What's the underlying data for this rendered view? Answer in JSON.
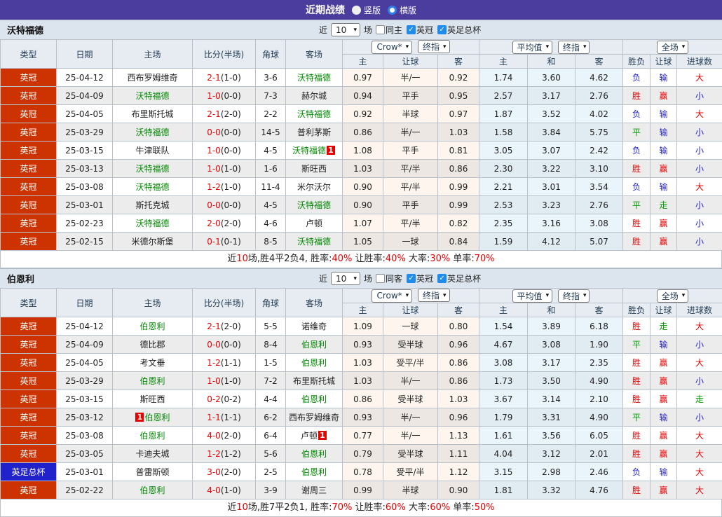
{
  "title_bar": {
    "title": "近期战绩",
    "options": [
      {
        "label": "竖版",
        "selected": true
      },
      {
        "label": "横版",
        "selected": false
      }
    ]
  },
  "icons": {
    "dropdown_arrow": "▾",
    "check": "✓"
  },
  "controls": {
    "near_label": "近",
    "count_value": "10",
    "games_label": "场"
  },
  "colors": {
    "accent_purple": "#4b3d9e",
    "league_red": "#cc3300",
    "league_blue": "#2222cc",
    "team_green": "#008800",
    "win_red": "#e60000",
    "lose_blue": "#2323cc",
    "draw_green": "#009900",
    "checkbox_blue": "#1f8ceb",
    "avg_col_bg": "#e9f4fb"
  },
  "header": {
    "left_cols": [
      "类型",
      "日期",
      "主场",
      "比分(半场)",
      "角球",
      "客场"
    ],
    "group_selects": {
      "g1a": "Crow*",
      "g1b": "终指",
      "g2a": "平均值",
      "g2b": "终指",
      "g3a": "全场"
    },
    "sub_cols": [
      "主",
      "让球",
      "客",
      "主",
      "和",
      "客",
      "胜负",
      "让球",
      "进球数"
    ]
  },
  "sections": [
    {
      "team": "沃特福德",
      "checkboxes": [
        {
          "label": "同主",
          "checked": false
        },
        {
          "label": "英冠",
          "checked": true
        },
        {
          "label": "英足总杯",
          "checked": true
        }
      ],
      "rows": [
        {
          "league": "英冠",
          "league_style": "red",
          "date": "25-04-12",
          "home": {
            "name": "西布罗姆维奇",
            "green": false
          },
          "score": "2-1",
          "half": "(1-0)",
          "corner": "3-6",
          "away": {
            "name": "沃特福德",
            "green": true
          },
          "odds": [
            "0.97",
            "半/一",
            "0.92",
            "1.74",
            "3.60",
            "4.62"
          ],
          "results": [
            [
              "负",
              "b"
            ],
            [
              "输",
              "b"
            ],
            [
              "大",
              "r"
            ]
          ]
        },
        {
          "league": "英冠",
          "league_style": "red",
          "date": "25-04-09",
          "home": {
            "name": "沃特福德",
            "green": true
          },
          "score": "1-0",
          "half": "(0-0)",
          "corner": "7-3",
          "away": {
            "name": "赫尔城",
            "green": false
          },
          "odds": [
            "0.94",
            "平手",
            "0.95",
            "2.57",
            "3.17",
            "2.76"
          ],
          "results": [
            [
              "胜",
              "r"
            ],
            [
              "赢",
              "r"
            ],
            [
              "小",
              "b"
            ]
          ]
        },
        {
          "league": "英冠",
          "league_style": "red",
          "date": "25-04-05",
          "home": {
            "name": "布里斯托城",
            "green": false
          },
          "score": "2-1",
          "half": "(2-0)",
          "corner": "2-2",
          "away": {
            "name": "沃特福德",
            "green": true
          },
          "odds": [
            "0.92",
            "半球",
            "0.97",
            "1.87",
            "3.52",
            "4.02"
          ],
          "results": [
            [
              "负",
              "b"
            ],
            [
              "输",
              "b"
            ],
            [
              "大",
              "r"
            ]
          ]
        },
        {
          "league": "英冠",
          "league_style": "red",
          "date": "25-03-29",
          "home": {
            "name": "沃特福德",
            "green": true
          },
          "score": "0-0",
          "half": "(0-0)",
          "corner": "14-5",
          "away": {
            "name": "普利茅斯",
            "green": false
          },
          "odds": [
            "0.86",
            "半/一",
            "1.03",
            "1.58",
            "3.84",
            "5.75"
          ],
          "results": [
            [
              "平",
              "g"
            ],
            [
              "输",
              "b"
            ],
            [
              "小",
              "b"
            ]
          ]
        },
        {
          "league": "英冠",
          "league_style": "red",
          "date": "25-03-15",
          "home": {
            "name": "牛津联队",
            "green": false
          },
          "score": "1-0",
          "half": "(0-0)",
          "corner": "4-5",
          "away": {
            "name": "沃特福德",
            "green": true,
            "badge_after": "1"
          },
          "odds": [
            "1.08",
            "平手",
            "0.81",
            "3.05",
            "3.07",
            "2.42"
          ],
          "results": [
            [
              "负",
              "b"
            ],
            [
              "输",
              "b"
            ],
            [
              "小",
              "b"
            ]
          ]
        },
        {
          "league": "英冠",
          "league_style": "red",
          "date": "25-03-13",
          "home": {
            "name": "沃特福德",
            "green": true
          },
          "score": "1-0",
          "half": "(1-0)",
          "corner": "1-6",
          "away": {
            "name": "斯旺西",
            "green": false
          },
          "odds": [
            "1.03",
            "平/半",
            "0.86",
            "2.30",
            "3.22",
            "3.10"
          ],
          "results": [
            [
              "胜",
              "r"
            ],
            [
              "赢",
              "r"
            ],
            [
              "小",
              "b"
            ]
          ]
        },
        {
          "league": "英冠",
          "league_style": "red",
          "date": "25-03-08",
          "home": {
            "name": "沃特福德",
            "green": true
          },
          "score": "1-2",
          "half": "(1-0)",
          "corner": "11-4",
          "away": {
            "name": "米尔沃尔",
            "green": false
          },
          "odds": [
            "0.90",
            "平/半",
            "0.99",
            "2.21",
            "3.01",
            "3.54"
          ],
          "results": [
            [
              "负",
              "b"
            ],
            [
              "输",
              "b"
            ],
            [
              "大",
              "r"
            ]
          ]
        },
        {
          "league": "英冠",
          "league_style": "red",
          "date": "25-03-01",
          "home": {
            "name": "斯托克城",
            "green": false
          },
          "score": "0-0",
          "half": "(0-0)",
          "corner": "4-5",
          "away": {
            "name": "沃特福德",
            "green": true
          },
          "odds": [
            "0.90",
            "平手",
            "0.99",
            "2.53",
            "3.23",
            "2.76"
          ],
          "results": [
            [
              "平",
              "g"
            ],
            [
              "走",
              "g"
            ],
            [
              "小",
              "b"
            ]
          ]
        },
        {
          "league": "英冠",
          "league_style": "red",
          "date": "25-02-23",
          "home": {
            "name": "沃特福德",
            "green": true
          },
          "score": "2-0",
          "half": "(2-0)",
          "corner": "4-6",
          "away": {
            "name": "卢顿",
            "green": false
          },
          "odds": [
            "1.07",
            "平/半",
            "0.82",
            "2.35",
            "3.16",
            "3.08"
          ],
          "results": [
            [
              "胜",
              "r"
            ],
            [
              "赢",
              "r"
            ],
            [
              "小",
              "b"
            ]
          ]
        },
        {
          "league": "英冠",
          "league_style": "red",
          "date": "25-02-15",
          "home": {
            "name": "米德尔斯堡",
            "green": false
          },
          "score": "0-1",
          "half": "(0-1)",
          "corner": "8-5",
          "away": {
            "name": "沃特福德",
            "green": true
          },
          "odds": [
            "1.05",
            "一球",
            "0.84",
            "1.59",
            "4.12",
            "5.07"
          ],
          "results": [
            [
              "胜",
              "r"
            ],
            [
              "赢",
              "r"
            ],
            [
              "小",
              "b"
            ]
          ]
        }
      ],
      "summary": [
        [
          "近",
          "k"
        ],
        [
          "10",
          "r"
        ],
        [
          "场,胜4平2负4, 胜率:",
          "k"
        ],
        [
          "40%",
          "r"
        ],
        [
          " 让胜率:",
          "k"
        ],
        [
          "40%",
          "r"
        ],
        [
          " 大率:",
          "k"
        ],
        [
          "30%",
          "r"
        ],
        [
          " 单率:",
          "k"
        ],
        [
          "70%",
          "r"
        ]
      ]
    },
    {
      "team": "伯恩利",
      "checkboxes": [
        {
          "label": "同客",
          "checked": false
        },
        {
          "label": "英冠",
          "checked": true
        },
        {
          "label": "英足总杯",
          "checked": true
        }
      ],
      "rows": [
        {
          "league": "英冠",
          "league_style": "red",
          "date": "25-04-12",
          "home": {
            "name": "伯恩利",
            "green": true
          },
          "score": "2-1",
          "half": "(2-0)",
          "corner": "5-5",
          "away": {
            "name": "诺维奇",
            "green": false
          },
          "odds": [
            "1.09",
            "一球",
            "0.80",
            "1.54",
            "3.89",
            "6.18"
          ],
          "results": [
            [
              "胜",
              "r"
            ],
            [
              "走",
              "g"
            ],
            [
              "大",
              "r"
            ]
          ]
        },
        {
          "league": "英冠",
          "league_style": "red",
          "date": "25-04-09",
          "home": {
            "name": "德比郡",
            "green": false
          },
          "score": "0-0",
          "half": "(0-0)",
          "corner": "8-4",
          "away": {
            "name": "伯恩利",
            "green": true
          },
          "odds": [
            "0.93",
            "受半球",
            "0.96",
            "4.67",
            "3.08",
            "1.90"
          ],
          "results": [
            [
              "平",
              "g"
            ],
            [
              "输",
              "b"
            ],
            [
              "小",
              "b"
            ]
          ]
        },
        {
          "league": "英冠",
          "league_style": "red",
          "date": "25-04-05",
          "home": {
            "name": "考文垂",
            "green": false
          },
          "score": "1-2",
          "half": "(1-1)",
          "corner": "1-5",
          "away": {
            "name": "伯恩利",
            "green": true
          },
          "odds": [
            "1.03",
            "受平/半",
            "0.86",
            "3.08",
            "3.17",
            "2.35"
          ],
          "results": [
            [
              "胜",
              "r"
            ],
            [
              "赢",
              "r"
            ],
            [
              "大",
              "r"
            ]
          ]
        },
        {
          "league": "英冠",
          "league_style": "red",
          "date": "25-03-29",
          "home": {
            "name": "伯恩利",
            "green": true
          },
          "score": "1-0",
          "half": "(1-0)",
          "corner": "7-2",
          "away": {
            "name": "布里斯托城",
            "green": false
          },
          "odds": [
            "1.03",
            "半/一",
            "0.86",
            "1.73",
            "3.50",
            "4.90"
          ],
          "results": [
            [
              "胜",
              "r"
            ],
            [
              "赢",
              "r"
            ],
            [
              "小",
              "b"
            ]
          ]
        },
        {
          "league": "英冠",
          "league_style": "red",
          "date": "25-03-15",
          "home": {
            "name": "斯旺西",
            "green": false
          },
          "score": "0-2",
          "half": "(0-2)",
          "corner": "4-4",
          "away": {
            "name": "伯恩利",
            "green": true
          },
          "odds": [
            "0.86",
            "受半球",
            "1.03",
            "3.67",
            "3.14",
            "2.10"
          ],
          "results": [
            [
              "胜",
              "r"
            ],
            [
              "赢",
              "r"
            ],
            [
              "走",
              "g"
            ]
          ]
        },
        {
          "league": "英冠",
          "league_style": "red",
          "date": "25-03-12",
          "home": {
            "name": "伯恩利",
            "green": true,
            "badge_before": "1"
          },
          "score": "1-1",
          "half": "(1-1)",
          "corner": "6-2",
          "away": {
            "name": "西布罗姆维奇",
            "green": false
          },
          "odds": [
            "0.93",
            "半/一",
            "0.96",
            "1.79",
            "3.31",
            "4.90"
          ],
          "results": [
            [
              "平",
              "g"
            ],
            [
              "输",
              "b"
            ],
            [
              "小",
              "b"
            ]
          ]
        },
        {
          "league": "英冠",
          "league_style": "red",
          "date": "25-03-08",
          "home": {
            "name": "伯恩利",
            "green": true
          },
          "score": "4-0",
          "half": "(2-0)",
          "corner": "6-4",
          "away": {
            "name": "卢顿",
            "green": false,
            "badge_after": "1"
          },
          "odds": [
            "0.77",
            "半/一",
            "1.13",
            "1.61",
            "3.56",
            "6.05"
          ],
          "results": [
            [
              "胜",
              "r"
            ],
            [
              "赢",
              "r"
            ],
            [
              "大",
              "r"
            ]
          ]
        },
        {
          "league": "英冠",
          "league_style": "red",
          "date": "25-03-05",
          "home": {
            "name": "卡迪夫城",
            "green": false
          },
          "score": "1-2",
          "half": "(1-2)",
          "corner": "5-6",
          "away": {
            "name": "伯恩利",
            "green": true
          },
          "odds": [
            "0.79",
            "受半球",
            "1.11",
            "4.04",
            "3.12",
            "2.01"
          ],
          "results": [
            [
              "胜",
              "r"
            ],
            [
              "赢",
              "r"
            ],
            [
              "大",
              "r"
            ]
          ]
        },
        {
          "league": "英足总杯",
          "league_style": "blue",
          "date": "25-03-01",
          "home": {
            "name": "普雷斯顿",
            "green": false
          },
          "score": "3-0",
          "half": "(2-0)",
          "corner": "2-5",
          "away": {
            "name": "伯恩利",
            "green": true
          },
          "odds": [
            "0.78",
            "受平/半",
            "1.12",
            "3.15",
            "2.98",
            "2.46"
          ],
          "results": [
            [
              "负",
              "b"
            ],
            [
              "输",
              "b"
            ],
            [
              "大",
              "r"
            ]
          ]
        },
        {
          "league": "英冠",
          "league_style": "red",
          "date": "25-02-22",
          "home": {
            "name": "伯恩利",
            "green": true
          },
          "score": "4-0",
          "half": "(1-0)",
          "corner": "3-9",
          "away": {
            "name": "谢周三",
            "green": false
          },
          "odds": [
            "0.99",
            "半球",
            "0.90",
            "1.81",
            "3.32",
            "4.76"
          ],
          "results": [
            [
              "胜",
              "r"
            ],
            [
              "赢",
              "r"
            ],
            [
              "大",
              "r"
            ]
          ]
        }
      ],
      "summary": [
        [
          "近",
          "k"
        ],
        [
          "10",
          "r"
        ],
        [
          "场,胜7平2负1, 胜率:",
          "k"
        ],
        [
          "70%",
          "r"
        ],
        [
          " 让胜率:",
          "k"
        ],
        [
          "60%",
          "r"
        ],
        [
          " 大率:",
          "k"
        ],
        [
          "60%",
          "r"
        ],
        [
          " 单率:",
          "k"
        ],
        [
          "50%",
          "r"
        ]
      ]
    }
  ]
}
